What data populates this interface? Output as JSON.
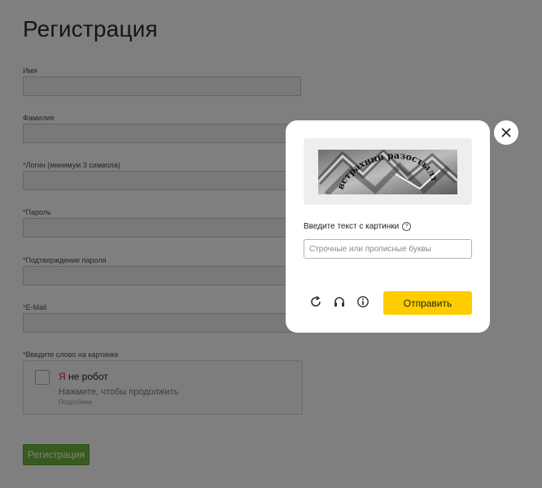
{
  "page": {
    "title": "Регистрация"
  },
  "form": {
    "fields": [
      {
        "label": "Имя",
        "required": false,
        "value": ""
      },
      {
        "label": "Фамилия",
        "required": false,
        "value": ""
      },
      {
        "label": "Логин (минимум 3 символа)",
        "required": true,
        "value": ""
      },
      {
        "label": "Пароль",
        "required": true,
        "value": ""
      },
      {
        "label": "Подтверждение пароля",
        "required": true,
        "value": ""
      },
      {
        "label": "E-Mail",
        "required": true,
        "value": ""
      }
    ],
    "captcha_label": "Введите слово на картинке",
    "required_mark": "*",
    "register_label": "Регистрация"
  },
  "smartcaptcha": {
    "brand_letter": "Я",
    "title": " не робот",
    "subtitle": "Нажмите, чтобы продолжить",
    "more_link": "Подробнее"
  },
  "modal": {
    "image_text": "встрахнин разостылт",
    "input_label": "Введите текст с картинки",
    "input_placeholder": "Строчные или прописные буквы",
    "input_value": "",
    "submit_label": "Отправить",
    "icons": [
      "refresh-icon",
      "headphones-icon",
      "info-icon",
      "close-icon",
      "help-icon"
    ]
  },
  "colors": {
    "overlay": "rgba(0,0,0,0.5)",
    "submit": "#ffcc00",
    "register": "#6fb63d",
    "required": "#c0392b",
    "brand": "#e52620"
  }
}
